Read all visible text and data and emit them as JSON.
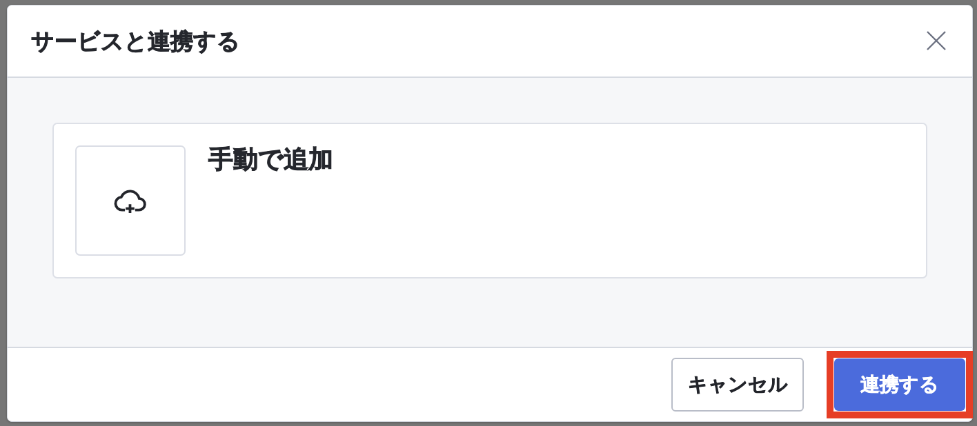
{
  "dialog": {
    "title": "サービスと連携する"
  },
  "options": [
    {
      "label": "手動で追加"
    }
  ],
  "buttons": [
    {
      "label": "キャンセル",
      "kind": "secondary",
      "highlighted": false
    },
    {
      "label": "連携する",
      "kind": "primary",
      "highlighted": true
    }
  ]
}
